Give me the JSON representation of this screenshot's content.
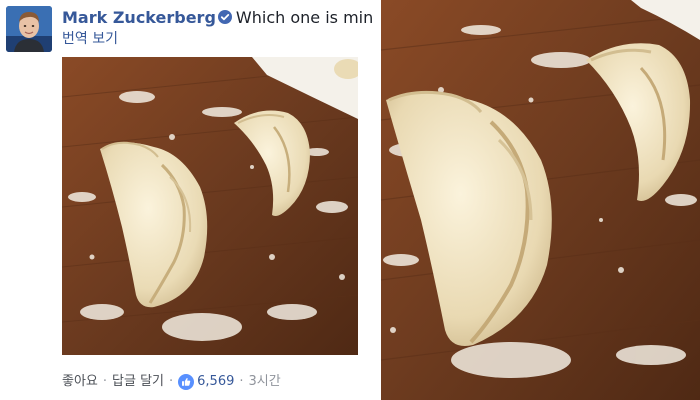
{
  "post": {
    "author": "Mark Zuckerberg",
    "message": "Which one is mine?",
    "translate_label": "번역 보기",
    "footer": {
      "like_label": "좋아요",
      "comment_label": "답글 달기",
      "like_count": "6,569",
      "timestamp": "3시간",
      "separator": "·"
    }
  },
  "icons": {
    "verified": "verified-badge-icon",
    "like": "thumbs-up-icon"
  },
  "colors": {
    "link_blue": "#365899",
    "like_blue": "#5890ff",
    "table_wood": "#6e3d22",
    "dough": "#efe5c9"
  }
}
